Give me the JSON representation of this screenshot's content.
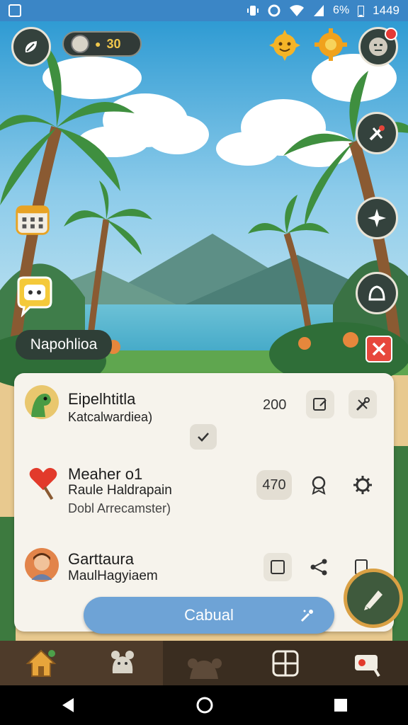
{
  "status_bar": {
    "battery": "6%",
    "time": "1449"
  },
  "top_hud": {
    "coins": "30"
  },
  "location_label": "Napohlioa",
  "list": {
    "items": [
      {
        "title": "Eipelhtitla",
        "subtitle": "Katcalwardiea)",
        "value": "200"
      },
      {
        "title": "Meaher o1",
        "subtitle": "Raule Haldrapain",
        "subtitle2": "Dobl Arrecamster)",
        "value": "470"
      },
      {
        "title": "Garttaura",
        "subtitle": "MaulHagyiaem"
      }
    ]
  },
  "primary_button": {
    "label": "Cabual"
  },
  "icons": {
    "profile": "leaf-icon",
    "friend": "smiley-sun-icon",
    "settings": "gear-sun-icon",
    "notification_avatar": "avatar-icon",
    "tools": "tools-icon",
    "compass": "compass-icon",
    "shop": "bag-icon",
    "calendar": "calendar-icon",
    "chat": "chat-icon",
    "close": "close-icon",
    "pen": "pen-icon"
  },
  "colors": {
    "accent_blue": "#6ea3d6",
    "close_red": "#e7473c",
    "hud_dark": "#34423d"
  }
}
